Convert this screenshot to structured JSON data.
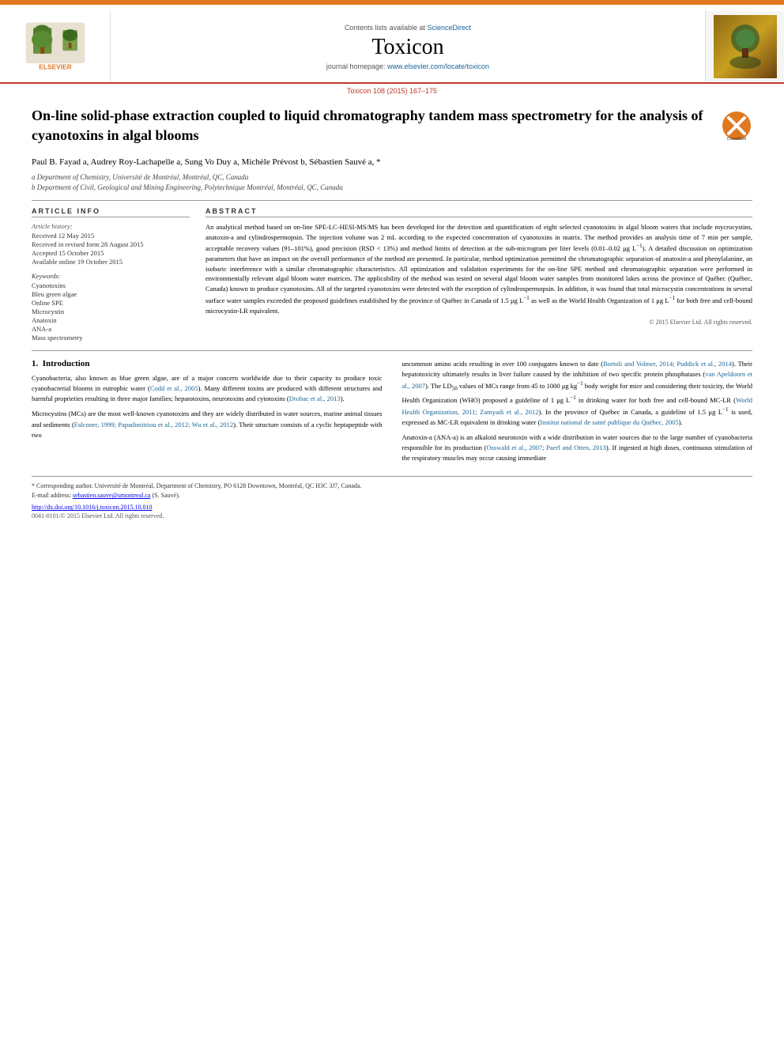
{
  "doi_bar": "Toxicon 108 (2015) 167–175",
  "header": {
    "contents_label": "Contents lists available at",
    "sciencedirect": "ScienceDirect",
    "journal_title": "Toxicon",
    "homepage_label": "journal homepage:",
    "homepage_url": "www.elsevier.com/locate/toxicon",
    "elsevier_label": "ELSEVIER"
  },
  "article": {
    "title": "On-line solid-phase extraction coupled to liquid chromatography tandem mass spectrometry for the analysis of cyanotoxins in algal blooms",
    "authors": "Paul B. Fayad a, Audrey Roy-Lachapelle a, Sung Vo Duy a, Michèle Prévost b, Sébastien Sauvé a, *",
    "affiliation_a": "a Department of Chemistry, Université de Montréal, Montréal, QC, Canada",
    "affiliation_b": "b Department of Civil, Geological and Mining Engineering, Polytechnique Montréal, Montréal, QC, Canada"
  },
  "article_info": {
    "section_label": "ARTICLE INFO",
    "history_label": "Article history:",
    "received": "Received 12 May 2015",
    "revised": "Received in revised form 28 August 2015",
    "accepted": "Accepted 15 October 2015",
    "available": "Available online 19 October 2015",
    "keywords_label": "Keywords:",
    "keywords": [
      "Cyanotoxins",
      "Bleu green algae",
      "Online SPE",
      "Microcystin",
      "Anatoxin",
      "ANA-a",
      "Mass spectrometry"
    ]
  },
  "abstract": {
    "section_label": "ABSTRACT",
    "text": "An analytical method based on on-line SPE-LC-HESI-MS/MS has been developed for the detection and quantification of eight selected cyanotoxins in algal bloom waters that include mycrocystins, anatoxin-a and cylindrospermopsin. The injection volume was 2 mL according to the expected concentration of cyanotoxins in matrix. The method provides an analysis time of 7 min per sample, acceptable recovery values (91–101%), good precision (RSD < 13%) and method limits of detection at the sub-microgram per liter levels (0.01–0.02 μg L⁻¹). A detailed discussion on optimization parameters that have an impact on the overall performance of the method are presented. In particular, method optimization permitted the chromatographic separation of anatoxin-a and phenylalanine, an isobaric interference with a similar chromatographic characteristics. All optimization and validation experiments for the on-line SPE method and chromatographic separation were performed in environmentally relevant algal bloom water matrices. The applicability of the method was tested on several algal bloom water samples from monitored lakes across the province of Québec (Québec, Canada) known to produce cyanotoxins. All of the targeted cyanotoxins were detected with the exception of cylindrospermopsin. In addition, it was found that total microcystin concentrations in several surface water samples exceeded the proposed guidelines established by the province of Québec in Canada of 1.5 μg L⁻¹ as well as the World Health Organization of 1 μg L⁻¹ for both free and cell-bound microcystin-LR equivalent.",
    "copyright": "© 2015 Elsevier Ltd. All rights reserved."
  },
  "intro": {
    "section_number": "1.",
    "section_title": "Introduction",
    "para1": "Cyanobacteria, also known as blue green algae, are of a major concern worldwide due to their capacity to produce toxic cyanobacterial blooms in eutrophic water (Codd et al., 2005). Many different toxins are produced with different structures and harmful proprieties resulting in three major families; hepatotoxins, neurotoxins and cytotoxins (Drobac et al., 2013).",
    "para2": "Microcystins (MCs) are the most well-known cyanotoxins and they are widely distributed in water sources, marine animal tissues and sediments (Falconer, 1999; Papadimitriou et al., 2012; Wu et al., 2012). Their structure consists of a cyclic heptapeptide with two",
    "para_right1": "uncommon amino acids resulting in over 100 conjugates known to date (Bortoli and Volmer, 2014; Puddick et al., 2014). Their hepatotoxicity ultimately results in liver failure caused by the inhibition of two specific protein phosphatases (van Apeldoorn et al., 2007). The LD₅₀ values of MCs range from 45 to 1000 μg kg⁻¹ body weight for mice and considering their toxicity, the World Health Organization (WHO) proposed a guideline of 1 μg L⁻¹ in drinking water for both free and cell-bound MC-LR (World Health Organization, 2011; Zamyadi et al., 2012). In the province of Québec in Canada, a guideline of 1.5 μg L⁻¹ is used, expressed as MC-LR equivalent in drinking water (Institut national de santé publique du Québec, 2005).",
    "para_right2": "Anatoxin-a (ANA-a) is an alkaloid neurotoxin with a wide distribution in water sources due to the large number of cyanobacteria responsible for its production (Osswald et al., 2007; Paerl and Otten, 2013). If ingested at high doses, continuous stimulation of the respiratory muscles may occur causing immediate"
  },
  "footnote": {
    "star_note": "* Corresponding author. Université de Montréal, Department of Chemistry, PO 6128 Downtown, Montréal, QC H3C 3J7, Canada.",
    "email_label": "E-mail address:",
    "email": "sebastien.sauve@umontreal.ca",
    "email_who": "(S. Sauvé).",
    "doi_link": "http://dx.doi.org/10.1016/j.toxicon.2015.10.010",
    "issn": "0041-0101/© 2015 Elsevier Ltd. All rights reserved."
  }
}
